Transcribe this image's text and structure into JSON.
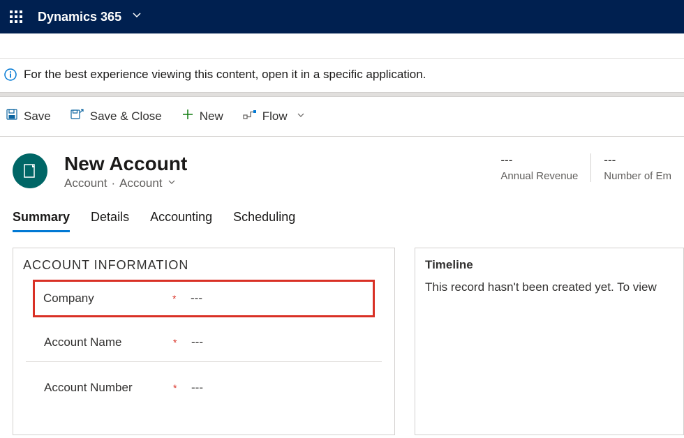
{
  "navbar": {
    "title": "Dynamics 365"
  },
  "notice": {
    "text": "For the best experience viewing this content, open it in a specific application."
  },
  "toolbar": {
    "save": "Save",
    "save_close": "Save & Close",
    "new": "New",
    "flow": "Flow"
  },
  "record": {
    "title": "New Account",
    "entity": "Account",
    "form": "Account"
  },
  "metrics": [
    {
      "value": "---",
      "label": "Annual Revenue"
    },
    {
      "value": "---",
      "label": "Number of Em"
    }
  ],
  "tabs": {
    "summary": "Summary",
    "details": "Details",
    "accounting": "Accounting",
    "scheduling": "Scheduling"
  },
  "section": {
    "title": "ACCOUNT INFORMATION",
    "fields": [
      {
        "label": "Company",
        "value": "---",
        "highlighted": true
      },
      {
        "label": "Account Name",
        "value": "---"
      },
      {
        "label": "Account Number",
        "value": "---"
      }
    ]
  },
  "timeline": {
    "title": "Timeline",
    "message": "This record hasn't been created yet.  To view "
  }
}
